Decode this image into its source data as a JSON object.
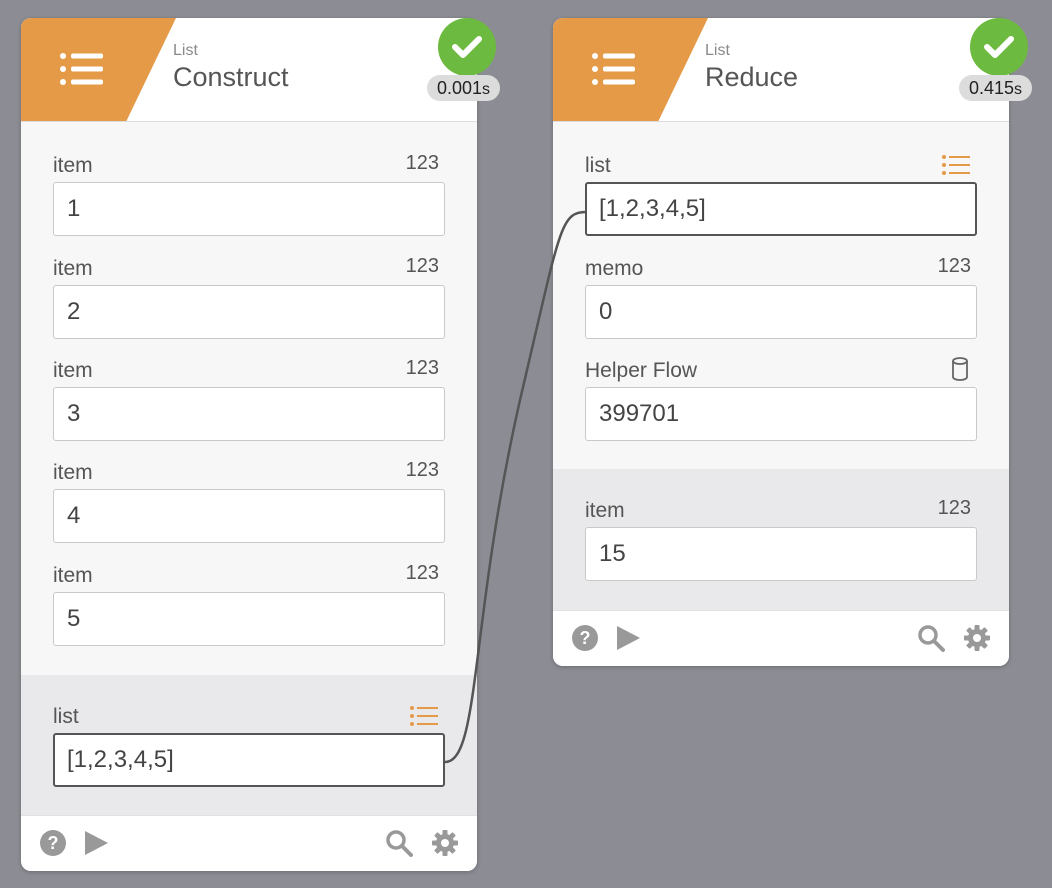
{
  "colors": {
    "canvas": "#8c8c94",
    "header_accent": "#e59a47",
    "status_ok": "#6cba3f",
    "wire": "#555555"
  },
  "nodes": {
    "construct": {
      "category": "List",
      "title": "Construct",
      "header_icon": "list-icon",
      "status_icon": "checkmark-icon",
      "elapsed_value": "0.001",
      "elapsed_unit": "s",
      "inputs": [
        {
          "label": "item",
          "type_badge": "123",
          "value": "1"
        },
        {
          "label": "item",
          "type_badge": "123",
          "value": "2"
        },
        {
          "label": "item",
          "type_badge": "123",
          "value": "3"
        },
        {
          "label": "item",
          "type_badge": "123",
          "value": "4"
        },
        {
          "label": "item",
          "type_badge": "123",
          "value": "5"
        }
      ],
      "output": {
        "label": "list",
        "type_icon": "list-type-icon",
        "value": "[1,2,3,4,5]"
      },
      "footer": [
        "help-icon",
        "play-icon",
        "search-icon",
        "gear-icon"
      ]
    },
    "reduce": {
      "category": "List",
      "title": "Reduce",
      "header_icon": "list-icon",
      "status_icon": "checkmark-icon",
      "elapsed_value": "0.415",
      "elapsed_unit": "s",
      "inputs": [
        {
          "label": "list",
          "type_icon": "list-type-icon",
          "value": "[1,2,3,4,5]"
        },
        {
          "label": "memo",
          "type_badge": "123",
          "value": "0"
        },
        {
          "label": "Helper Flow",
          "type_icon": "database-icon",
          "value": "399701"
        }
      ],
      "output": {
        "label": "item",
        "type_badge": "123",
        "value": "15"
      },
      "footer": [
        "help-icon",
        "play-icon",
        "search-icon",
        "gear-icon"
      ]
    }
  }
}
